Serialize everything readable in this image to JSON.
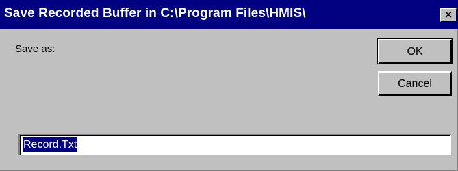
{
  "window": {
    "title": "Save Recorded Buffer in C:\\Program Files\\HMIS\\",
    "close_glyph": "×",
    "close_icon": "close-icon"
  },
  "form": {
    "save_as_label": "Save as:",
    "filename_value": "Record.Txt",
    "filename_selected": true
  },
  "buttons": {
    "ok_label": "OK",
    "cancel_label": "Cancel"
  },
  "colors": {
    "titlebar": "#000080",
    "face": "#c0c0c0",
    "selection": "#000080"
  }
}
